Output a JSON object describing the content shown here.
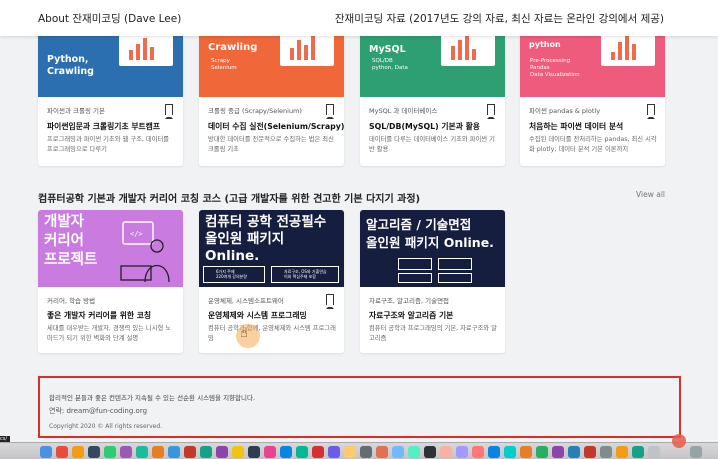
{
  "header": {
    "left": "About 잔재미코딩 (Dave Lee)",
    "right": "잔재미코딩 자료 (2017년도 강의 자료, 최신 자료는 온라인 강의에서 제공)"
  },
  "row1": [
    {
      "thumb_text": "Python,\nCrawling",
      "category": "파이썬과 크롤링 기본",
      "title": "파이썬입문과 크롤링기초 부트캠프",
      "desc": "프로그래밍과 파이썬 기초와 웹 구조, 데이터를 프로그래밍으로 다루기"
    },
    {
      "thumb_text": "Crawling",
      "thumb_sub": "Scrapy\nSelenium",
      "category": "크롤링 중급 (Scrapy/Selenium)",
      "title": "데이터 수집 실전(Selenium/Scrapy)",
      "desc": "방대한 데이터를 전문적으로 수집하는 법은 최신 크롤링 기초"
    },
    {
      "thumb_text": "MySQL",
      "thumb_sub": "SQL/DB\npython, Data",
      "category": "MySQL 과 데이터베이스",
      "title": "SQL/DB(MySQL) 기본과 활용",
      "desc": "데이터를 다루는 데이터베이스 기초와 파이썬 기반 활용"
    },
    {
      "thumb_text": "python",
      "thumb_sub": "Pre-Processing\nPandas\nData Visualization",
      "category": "파이썬 pandas & plotly",
      "title": "처음하는 파이썬 데이터 분석",
      "desc": "수집된 데이터를 전처리하는 pandas, 최신 시각화 plotly; 데이터 분석 기본 이론까지"
    }
  ],
  "section": {
    "title": "컴퓨터공학 기본과 개발자 커리어 코칭 코스 (고급 개발자를 위한 견고한 기본 다지기 과정)",
    "view_all": "View all"
  },
  "row2": [
    {
      "thumb_text": "개발자\n커리어\n프로젝트",
      "category": "커리어, 학습 방법",
      "title": "좋은 개발자 커리어를 위한 코칭",
      "desc": "세대를 대우받는 개발자, 경쟁력 있는 니시형 노마드가 되기 위한 벽화와 단계 설명"
    },
    {
      "thumb_text": "컴퓨터 공학 전공필수\n올인원 패키지\nOnline.",
      "badge1": "6가지 주제\n220여개 강의분량",
      "badge2": "자료구조, OS와 기출연습\n이외 핵심주제 포함",
      "category": "운영체제, 시스템소프트웨어",
      "title": "운영체제와 시스템 프로그래밍",
      "desc": "컴퓨터 공학과 함께, 운영체제와 시스템 프로그래밍"
    },
    {
      "thumb_text": "알고리즘 / 기술면접\n올인원 패키지 Online.",
      "category": "자료구조, 알고리즘, 기술면접",
      "title": "자료구조와 알고리즘 기본",
      "desc": "컴퓨터 공학과 프로그래밍의 기본, 자료구조와 알고리즘"
    }
  ],
  "footer": {
    "line1": "합리적인 분들과 좋은 컨텐츠가 지속될 수 있는 선순환 시스템을 지향합니다.",
    "contact": "연락: dream@fun-coding.org",
    "copyright": "Copyright 2020 © All rights reserved."
  },
  "dock": {
    "left_label": "cs/"
  },
  "colors": {
    "footer_border": "#d93025",
    "card_blue": "#2c6fb0",
    "card_orange": "#f0673a",
    "card_green": "#2e9e73",
    "card_pink": "#ef5b7c",
    "card_purple": "#c97be0",
    "card_navy": "#161e3f"
  }
}
